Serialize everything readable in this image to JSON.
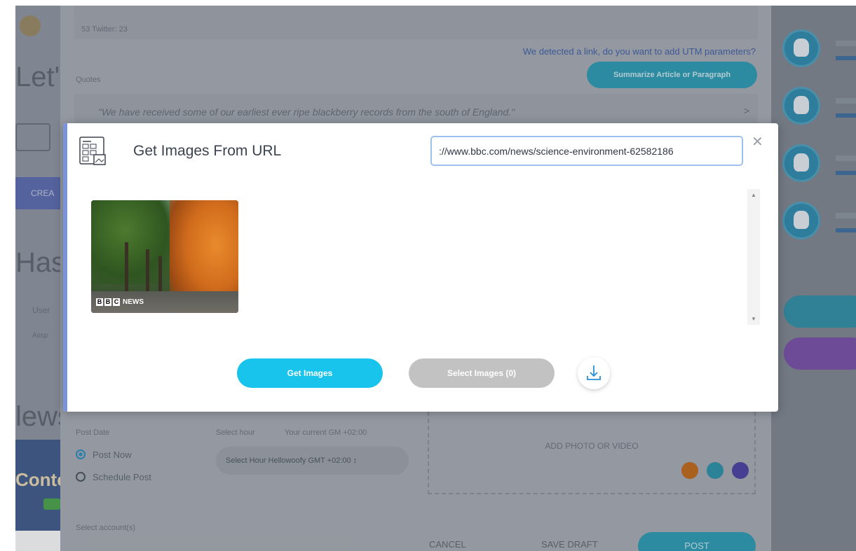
{
  "background": {
    "left_column": {
      "lets_heading": "Let's",
      "create_button": "CREA",
      "has_heading": "Has",
      "user_label": "User",
      "assp_label": "Assp",
      "news_heading": "lews",
      "promo_text": "Conte"
    },
    "composer": {
      "counts": "53  Twitter: 23",
      "utm_notice": "We detected a link, do you want to add UTM parameters?",
      "summarize_button": "Summarize Article or Paragraph",
      "quotes_label": "Quotes",
      "quote_text": "\"We have received some of our earliest ever ripe blackberry records from the south of England.\"",
      "quote_next": ">",
      "post_date_label": "Post Date",
      "select_hour_label": "Select hour",
      "current_gmt": "Your current GM +02:00",
      "post_now": "Post Now",
      "schedule_post": "Schedule Post",
      "hour_select_value": "Select Hour  Hellowoofy GMT +02:00  ↕",
      "add_media": "ADD PHOTO OR VIDEO",
      "select_accounts": "Select account(s)",
      "cancel_button": "CANCEL",
      "save_draft_button": "SAVE DRAFT",
      "post_button": "POST"
    },
    "colors": {
      "accent_teal": "#2a9bb5",
      "link_blue": "#3f5fa8"
    }
  },
  "modal": {
    "title": "Get Images From URL",
    "url_value": "://www.bbc.com/news/science-environment-62582186",
    "close_icon": "close-icon",
    "image_icon": "gallery-icon",
    "thumbnail_caption": "NEWS",
    "thumbnail_logo": [
      "B",
      "B",
      "C"
    ],
    "get_images_button": "Get Images",
    "select_images_button": "Select Images (0)",
    "download_icon": "download-icon",
    "colors": {
      "get_button": "#19c4ec",
      "select_button_disabled": "#c2c2c2",
      "url_border": "#9ec0ee"
    }
  }
}
